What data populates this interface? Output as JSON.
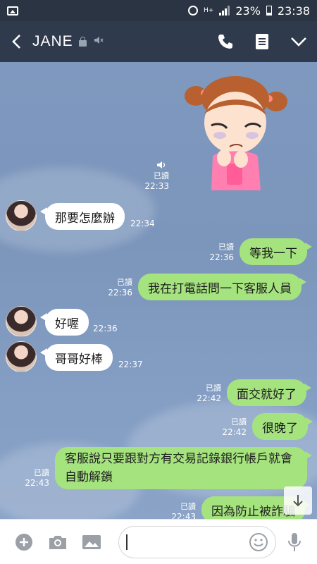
{
  "status_bar": {
    "network": "H+",
    "battery": "23%",
    "time": "23:38"
  },
  "header": {
    "title": "JANE"
  },
  "stamp": {
    "read": "已讀",
    "time": "22:33"
  },
  "messages": [
    {
      "side": "in",
      "text": "那要怎麼辦",
      "time": "22:34"
    },
    {
      "side": "out",
      "text": "等我一下",
      "read": "已讀",
      "time": "22:36"
    },
    {
      "side": "out",
      "text": "我在打電話問一下客服人員",
      "read": "已讀",
      "time": "22:36"
    },
    {
      "side": "in",
      "text": "好喔",
      "time": "22:36"
    },
    {
      "side": "in",
      "text": "哥哥好棒",
      "time": "22:37"
    },
    {
      "side": "out",
      "text": "面交就好了",
      "read": "已讀",
      "time": "22:42"
    },
    {
      "side": "out",
      "text": "很晚了",
      "read": "已讀",
      "time": "22:42"
    },
    {
      "side": "out",
      "text": "客服說只要跟對方有交易記錄銀行帳戶就會自動解鎖",
      "read": "已讀",
      "time": "22:43"
    },
    {
      "side": "out",
      "text": "因為防止被詐騙",
      "read": "已讀",
      "time": "22:43"
    }
  ],
  "input": {
    "value": ""
  },
  "colors": {
    "header_bg": "#2f3b4d",
    "status_bg": "#2a3442",
    "chat_bg": "#7f98bf",
    "outgoing": "#a5e37f",
    "incoming": "#ffffff"
  }
}
